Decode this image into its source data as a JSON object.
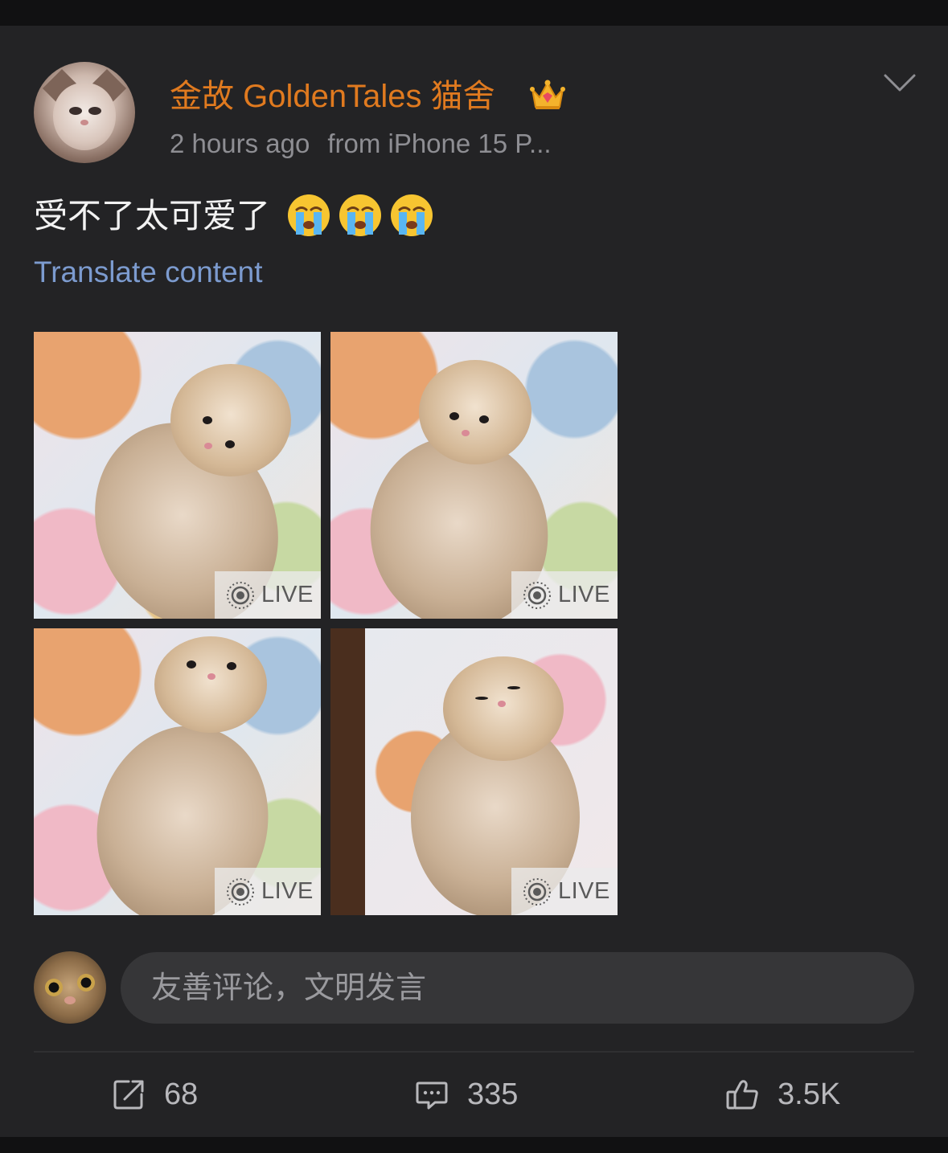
{
  "post": {
    "username": "金故 GoldenTales 猫舍",
    "badge_icon": "crown-icon",
    "time": "2 hours ago",
    "source": "from iPhone 15 P...",
    "text": "受不了太可爱了",
    "emojis": [
      "crying-emoji",
      "crying-emoji",
      "crying-emoji"
    ],
    "translate_label": "Translate content",
    "photos": [
      {
        "badge": "LIVE"
      },
      {
        "badge": "LIVE"
      },
      {
        "badge": "LIVE"
      },
      {
        "badge": "LIVE"
      }
    ]
  },
  "comment": {
    "placeholder": "友善评论，文明发言"
  },
  "actions": {
    "repost_count": "68",
    "comment_count": "335",
    "like_count": "3.5K"
  },
  "colors": {
    "username": "#e07a1f",
    "translate": "#7c9bcf",
    "background": "#232325"
  }
}
